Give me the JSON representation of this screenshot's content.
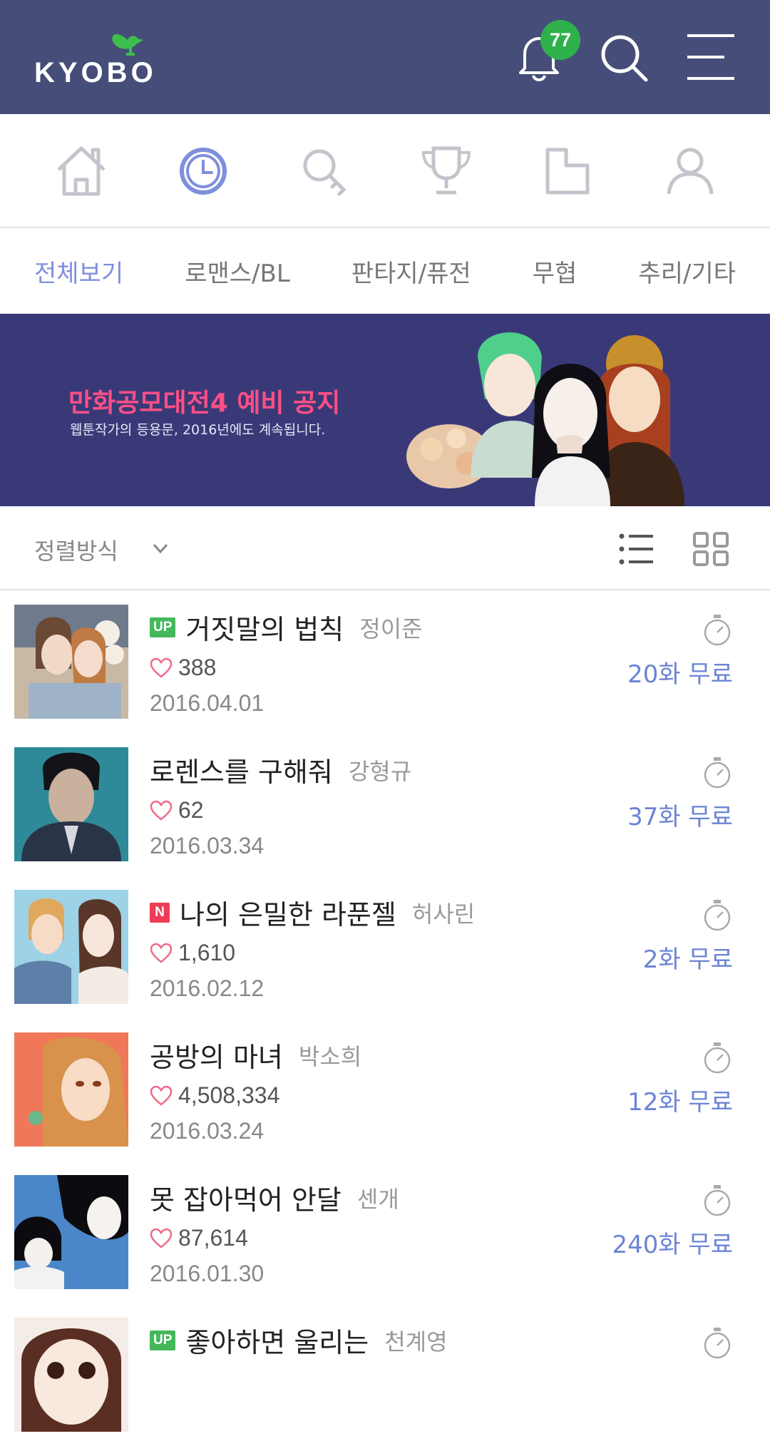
{
  "brand": {
    "logo_text": "KYOBO"
  },
  "header": {
    "notification_count": "77"
  },
  "nav_icons": [
    "home-icon",
    "recent-clock-icon",
    "search-icon",
    "trophy-icon",
    "folder-icon",
    "profile-icon"
  ],
  "categories": [
    {
      "label": "전체보기",
      "active": true
    },
    {
      "label": "로맨스/BL",
      "active": false
    },
    {
      "label": "판타지/퓨전",
      "active": false
    },
    {
      "label": "무협",
      "active": false
    },
    {
      "label": "추리/기타",
      "active": false
    }
  ],
  "banner": {
    "title": "만화공모대전4 예비 공지",
    "subtitle": "웹툰작가의 등용문, 2016년에도 계속됩니다."
  },
  "sort": {
    "label": "정렬방식"
  },
  "list": [
    {
      "tag": "UP",
      "title": "거짓말의 법칙",
      "author": "정이준",
      "likes": "388",
      "date": "2016.04.01",
      "free": "20화 무료"
    },
    {
      "tag": "",
      "title": "로렌스를 구해줘",
      "author": "강형규",
      "likes": "62",
      "date": "2016.03.34",
      "free": "37화 무료"
    },
    {
      "tag": "N",
      "title": "나의 은밀한 라푼젤",
      "author": "허사린",
      "likes": "1,610",
      "date": "2016.02.12",
      "free": "2화 무료"
    },
    {
      "tag": "",
      "title": "공방의 마녀",
      "author": "박소희",
      "likes": "4,508,334",
      "date": "2016.03.24",
      "free": "12화 무료"
    },
    {
      "tag": "",
      "title": "못 잡아먹어 안달",
      "author": "센개",
      "likes": "87,614",
      "date": "2016.01.30",
      "free": "240화 무료"
    },
    {
      "tag": "UP",
      "title": "좋아하면 울리는",
      "author": "천계영",
      "likes": "",
      "date": "",
      "free": ""
    }
  ],
  "colors": {
    "header_bg": "#464d78",
    "accent": "#7f8fdc",
    "banner_bg": "#3a3978",
    "badge": "#2eb14a",
    "free_text": "#6c84d4"
  }
}
